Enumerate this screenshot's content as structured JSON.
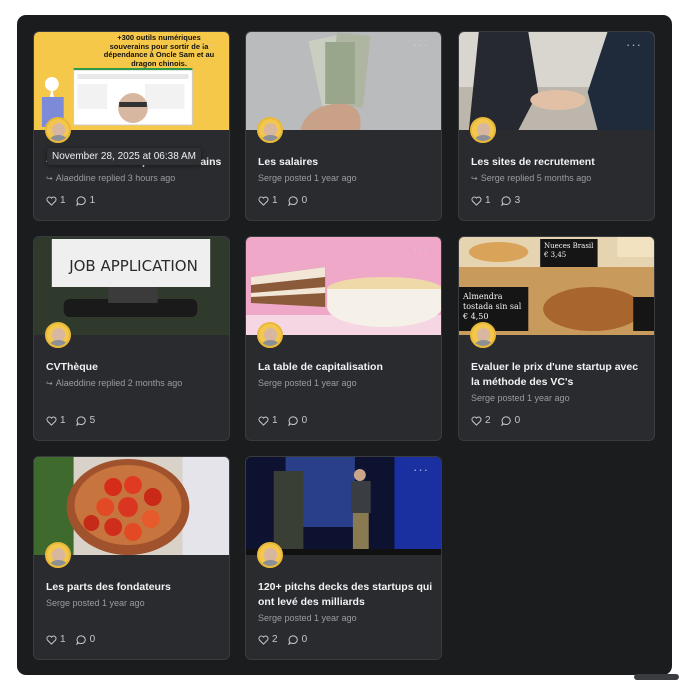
{
  "tooltip": "November 28, 2025 at 06:38 AM",
  "cards": [
    {
      "title": "+300 outils numériques souverains",
      "meta": "Alaeddine replied 3 hours ago",
      "reply": true,
      "likes": "1",
      "comments": "1",
      "img_text": "+300 outils numériques souverains pour sortir de la dépendance à Oncle Sam et au dragon chinois."
    },
    {
      "title": "Les salaires",
      "meta": "Serge posted 1 year ago",
      "reply": false,
      "likes": "1",
      "comments": "0"
    },
    {
      "title": "Les sites de recrutement",
      "meta": "Serge replied 5 months ago",
      "reply": true,
      "likes": "1",
      "comments": "3"
    },
    {
      "title": "CVThèque",
      "meta": "Alaeddine replied 2 months ago",
      "reply": true,
      "likes": "1",
      "comments": "5",
      "img_text": "JOB APPLICATION"
    },
    {
      "title": "La table de capitalisation",
      "meta": "Serge posted 1 year ago",
      "reply": false,
      "likes": "1",
      "comments": "0"
    },
    {
      "title": "Evaluer le prix d'une startup avec la méthode des VC's",
      "meta": "Serge posted 1 year ago",
      "reply": false,
      "likes": "2",
      "comments": "0",
      "img_text": "Almendra tostada sin sal € 4,50",
      "img_text2": "Nueces Brasil € 3,45"
    },
    {
      "title": "Les parts des fondateurs",
      "meta": "Serge posted 1 year ago",
      "reply": false,
      "likes": "1",
      "comments": "0"
    },
    {
      "title": "120+ pitchs decks des startups qui ont levé des milliards",
      "meta": "Serge posted 1 year ago",
      "reply": false,
      "likes": "2",
      "comments": "0"
    }
  ],
  "icons": {
    "like": "heart-icon",
    "comment": "comment-bubble-icon",
    "reply": "reply-arrow-icon",
    "more": "more-dots-icon"
  }
}
